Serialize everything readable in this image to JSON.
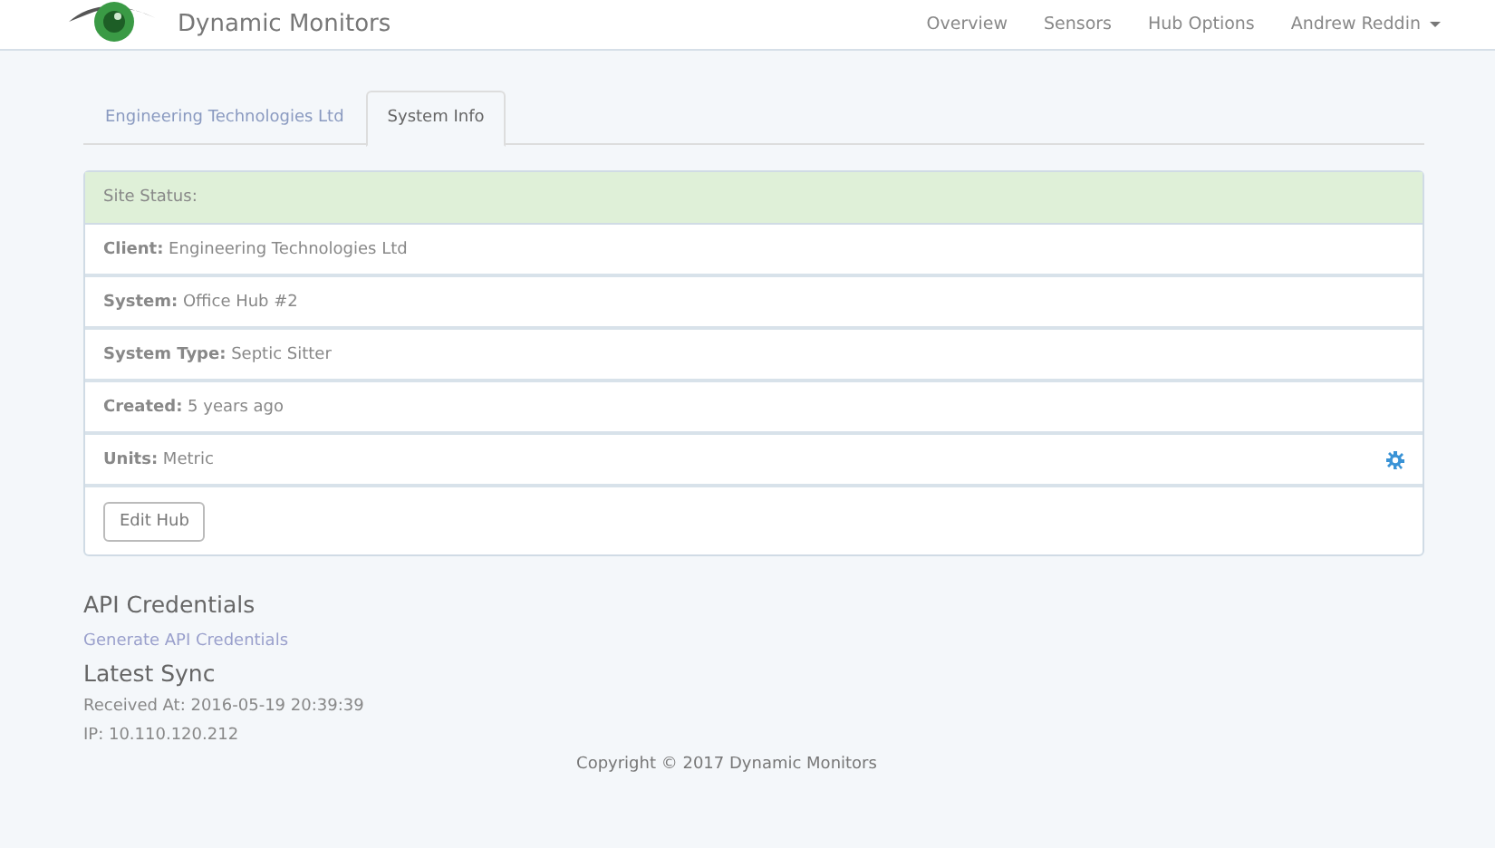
{
  "navbar": {
    "brand": "Dynamic Monitors",
    "links": [
      "Overview",
      "Sensors",
      "Hub Options"
    ],
    "user": "Andrew Reddin"
  },
  "tabs": [
    {
      "label": "Engineering Technologies Ltd",
      "selected": false
    },
    {
      "label": "System Info",
      "selected": true
    }
  ],
  "panel": {
    "heading": "Site Status:",
    "rows": [
      {
        "kind": "plain",
        "text": "**Client:** Engineering Technologies Ltd"
      },
      {
        "kind": "plain",
        "text": "**System:** Office Hub #2"
      },
      {
        "kind": "plain",
        "text": "**System Type:** Septic Sitter"
      },
      {
        "kind": "plain",
        "text": "**Created:** 5 years ago"
      },
      {
        "kind": "setting",
        "text": "**Units:** Metric"
      }
    ],
    "button": "Edit Hub"
  },
  "api": {
    "title": "API Credentials",
    "link": "Generate API Credentials"
  },
  "sync": {
    "title": "Latest Sync",
    "received": "Received At: 2016-05-19 20:39:39",
    "ip": "IP: 10.110.120.212"
  },
  "footer": "Copyright © 2017 Dynamic Monitors"
}
